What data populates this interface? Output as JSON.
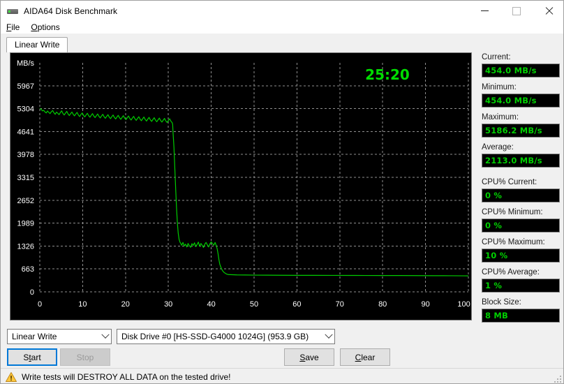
{
  "window": {
    "title": "AIDA64 Disk Benchmark",
    "icon": "disk-drive-icon",
    "controls": {
      "minimize": "minimize-icon",
      "maximize": "maximize-icon",
      "close": "close-icon"
    }
  },
  "menubar": {
    "items": [
      {
        "label": "File",
        "mnemonic": "F"
      },
      {
        "label": "Options",
        "mnemonic": "O"
      }
    ]
  },
  "tabs": [
    {
      "label": "Linear Write",
      "active": true
    }
  ],
  "chart_data": {
    "type": "line",
    "title": "",
    "xlabel": "%",
    "ylabel": "MB/s",
    "xlim": [
      0,
      100
    ],
    "ylim": [
      0,
      6630
    ],
    "grid": true,
    "legend": false,
    "background": "#000000",
    "line_color": "#00cc00",
    "grid_color": "#909090",
    "axis_text_color": "#ffffff",
    "overlay_timer": "25:20",
    "overlay_timer_color": "#00dd00",
    "xticks": [
      0,
      10,
      20,
      30,
      40,
      50,
      60,
      70,
      80,
      90,
      100
    ],
    "xtick_labels": [
      "0",
      "10",
      "20",
      "30",
      "40",
      "50",
      "60",
      "70",
      "80",
      "90",
      "100 %"
    ],
    "yticks": [
      0,
      663,
      1326,
      1989,
      2652,
      3315,
      3978,
      4641,
      5304,
      5967
    ],
    "ytick_labels": [
      "0",
      "663",
      "1326",
      "1989",
      "2652",
      "3315",
      "3978",
      "4641",
      "5304",
      "5967"
    ],
    "series": [
      {
        "name": "Linear Write",
        "x": [
          0.0,
          0.3,
          0.6,
          0.9,
          1.2,
          1.5,
          1.8,
          2.1,
          2.4,
          2.7,
          3.0,
          3.3,
          3.6,
          3.9,
          4.2,
          4.5,
          4.8,
          5.1,
          5.4,
          5.7,
          6.0,
          6.3,
          6.6,
          6.9,
          7.2,
          7.5,
          7.8,
          8.1,
          8.4,
          8.7,
          9.0,
          9.3,
          9.6,
          9.9,
          10.2,
          10.5,
          10.8,
          11.1,
          11.4,
          11.7,
          12.0,
          12.3,
          12.6,
          12.9,
          13.2,
          13.5,
          13.8,
          14.1,
          14.4,
          14.7,
          15.0,
          15.3,
          15.6,
          15.9,
          16.2,
          16.5,
          16.8,
          17.1,
          17.4,
          17.7,
          18.0,
          18.3,
          18.6,
          18.9,
          19.2,
          19.5,
          19.8,
          20.1,
          20.4,
          20.7,
          21.0,
          21.3,
          21.6,
          21.9,
          22.2,
          22.5,
          22.8,
          23.1,
          23.4,
          23.7,
          24.0,
          24.3,
          24.6,
          24.9,
          25.2,
          25.5,
          25.8,
          26.1,
          26.4,
          26.7,
          27.0,
          27.3,
          27.6,
          27.9,
          28.2,
          28.5,
          28.8,
          29.1,
          29.4,
          29.7,
          30.0,
          30.3,
          30.6,
          30.9,
          31.0,
          31.1,
          31.3,
          31.5,
          31.7,
          31.9,
          32.1,
          32.3,
          32.5,
          32.7,
          32.9,
          33.1,
          33.4,
          33.7,
          34.0,
          34.3,
          34.6,
          34.9,
          35.2,
          35.5,
          35.8,
          36.1,
          36.4,
          36.7,
          37.0,
          37.3,
          37.6,
          37.9,
          38.2,
          38.5,
          38.8,
          39.1,
          39.4,
          39.7,
          40.0,
          40.3,
          40.6,
          40.9,
          41.0,
          41.2,
          41.4,
          41.6,
          41.8,
          42.0,
          42.3,
          42.6,
          43.0,
          43.5,
          44.0,
          45.0,
          46.0,
          48.0,
          50.0,
          53.0,
          56.0,
          60.0,
          64.0,
          68.0,
          72.0,
          76.0,
          80.0,
          84.0,
          88.0,
          92.0,
          96.0,
          99.0,
          100.0
        ],
        "y": [
          5310,
          5290,
          5240,
          5255,
          5210,
          5180,
          5235,
          5195,
          5160,
          5215,
          5250,
          5185,
          5140,
          5205,
          5170,
          5130,
          5190,
          5240,
          5165,
          5120,
          5175,
          5225,
          5150,
          5105,
          5160,
          5205,
          5140,
          5095,
          5150,
          5195,
          5120,
          5075,
          5135,
          5180,
          5110,
          5065,
          5120,
          5170,
          5100,
          5055,
          5110,
          5160,
          5090,
          5045,
          5100,
          5150,
          5080,
          5035,
          5090,
          5140,
          5070,
          5025,
          5080,
          5130,
          5060,
          5015,
          5070,
          5120,
          5050,
          5005,
          5060,
          5110,
          5040,
          4995,
          5050,
          5100,
          5030,
          4985,
          5040,
          5090,
          5020,
          4975,
          5030,
          5080,
          5010,
          4965,
          5020,
          5070,
          5000,
          4955,
          5010,
          5060,
          4990,
          4945,
          5000,
          5050,
          4980,
          4935,
          4990,
          5040,
          4970,
          4925,
          4980,
          5030,
          4960,
          4915,
          4970,
          5020,
          4950,
          4905,
          4960,
          5010,
          4940,
          4895,
          4850,
          4600,
          4200,
          3600,
          3000,
          2450,
          2000,
          1700,
          1520,
          1440,
          1400,
          1350,
          1430,
          1330,
          1380,
          1300,
          1400,
          1335,
          1290,
          1395,
          1345,
          1420,
          1310,
          1370,
          1440,
          1320,
          1400,
          1345,
          1285,
          1380,
          1430,
          1360,
          1300,
          1390,
          1445,
          1395,
          1350,
          1430,
          1400,
          1330,
          1240,
          1100,
          930,
          800,
          700,
          620,
          560,
          520,
          500,
          495,
          490,
          487,
          484,
          482,
          480,
          478,
          477,
          476,
          475,
          474,
          473,
          472,
          470,
          468,
          466,
          464,
          462,
          460
        ]
      }
    ]
  },
  "stats": [
    {
      "label": "Current:",
      "value": "454.0 MB/s",
      "gap": false
    },
    {
      "label": "Minimum:",
      "value": "454.0 MB/s",
      "gap": false
    },
    {
      "label": "Maximum:",
      "value": "5186.2 MB/s",
      "gap": false
    },
    {
      "label": "Average:",
      "value": "2113.0 MB/s",
      "gap": false
    },
    {
      "label": "CPU% Current:",
      "value": "0 %",
      "gap": true
    },
    {
      "label": "CPU% Minimum:",
      "value": "0 %",
      "gap": false
    },
    {
      "label": "CPU% Maximum:",
      "value": "10 %",
      "gap": false
    },
    {
      "label": "CPU% Average:",
      "value": "1 %",
      "gap": false
    },
    {
      "label": "Block Size:",
      "value": "8 MB",
      "gap": false
    }
  ],
  "controls": {
    "mode_combo": {
      "value": "Linear Write"
    },
    "drive_combo": {
      "value": "Disk Drive #0  [HS-SSD-G4000 1024G]  (953.9 GB)"
    },
    "start_button": {
      "label": "Start",
      "mnemonic": "t",
      "enabled": true
    },
    "stop_button": {
      "label": "Stop",
      "mnemonic": "S",
      "enabled": false
    },
    "save_button": {
      "label": "Save",
      "mnemonic": "S",
      "enabled": true
    },
    "clear_button": {
      "label": "Clear",
      "mnemonic": "C",
      "enabled": true
    }
  },
  "statusbar": {
    "icon": "warning-triangle-icon",
    "text": "Write tests will DESTROY ALL DATA on the tested drive!"
  },
  "colors": {
    "accent": "#0078d7",
    "terminal_green": "#00d000",
    "chart_line": "#00cc00",
    "warning": "#e8a317"
  }
}
